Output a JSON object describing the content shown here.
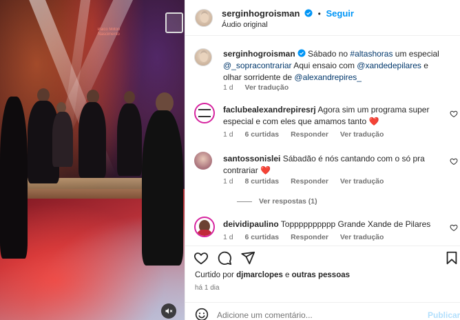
{
  "post": {
    "username": "serginhogroisman",
    "follow_label": "Seguir",
    "dot": "•",
    "audio": "Áudio original"
  },
  "caption": {
    "username": "serginhogroisman",
    "text_1": " Sábado no ",
    "tag_1": "#altashoras",
    "text_2": " um especial ",
    "tag_2": "@_sopracontrariar",
    "text_3": " Aqui ensaio com ",
    "tag_3": "@xandedepilares",
    "text_4": " e olhar sorridente de ",
    "tag_4": "@alexandrepires_",
    "time": "1 d",
    "translate": "Ver tradução"
  },
  "comments": [
    {
      "username": "faclubealexandrepiresrj",
      "text": " Agora sim um programa super especial e com eles que amamos tanto ❤️",
      "time": "1 d",
      "likes": "6 curtidas",
      "reply": "Responder",
      "translate": "Ver tradução"
    },
    {
      "username": "santossonislei",
      "text": " Sábadão é nós cantando com o só pra contrariar ❤️",
      "time": "1 d",
      "likes": "8 curtidas",
      "reply": "Responder",
      "translate": "Ver tradução",
      "view_replies": "Ver respostas (1)"
    },
    {
      "username": "deividipaulino",
      "text": " Topppppppppp Grande Xande de Pilares",
      "time": "1 d",
      "likes": "6 curtidas",
      "reply": "Responder",
      "translate": "Ver tradução"
    }
  ],
  "stage_sign": "Palco Milton Nascimento",
  "likes_summary": {
    "prefix": "Curtido por ",
    "user": "djmarclopes",
    "middle": " e ",
    "others": "outras pessoas"
  },
  "post_time": "há 1 dia",
  "comment_box": {
    "placeholder": "Adicione um comentário...",
    "publish": "Publicar"
  },
  "colors": {
    "accent": "#0095f6",
    "verified": "#0095f6",
    "heart": "#ed4956"
  },
  "icons": [
    "heart-icon",
    "comment-icon",
    "share-icon",
    "bookmark-icon",
    "emoji-icon",
    "mute-icon",
    "verified-icon"
  ]
}
